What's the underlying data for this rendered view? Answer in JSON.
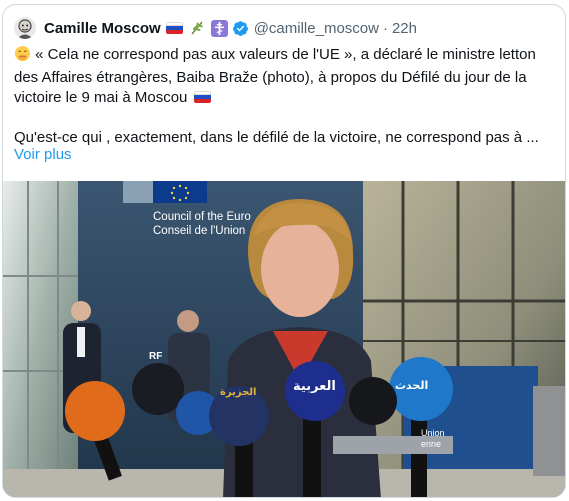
{
  "tweet": {
    "author": {
      "display_name": "Camille Moscow",
      "handle": "@camille_moscow",
      "separator": "·",
      "time": "22h",
      "avatar_icon": "avatar-illustration-icon",
      "badges": [
        "russia-flag-icon",
        "olive-sprig-icon",
        "orthodox-cross-icon",
        "verified-badge-icon"
      ]
    },
    "text": {
      "line1_pre": "« Cela ne correspond pas aux valeurs de l'UE », a déclaré le ministre letton des Affaires étrangères, Baiba Braže (photo), à propos du Défilé du jour de la victoire le 9 mai à Moscou",
      "line2": "Qu'est-ce qui , exactement, dans le défilé de la victoire, ne correspond pas à ..."
    },
    "show_more": "Voir plus",
    "colors": {
      "link": "#1d9bf0",
      "secondary_text": "#536471",
      "verified": "#1d9bf0",
      "eu_blue": "#0d3b8c"
    }
  },
  "photo": {
    "sign": {
      "line1": "Council of the Euro",
      "line2": "Conseil de l'Union"
    },
    "background_sign_bottom": {
      "line1": "Union",
      "line2": "enne"
    },
    "mic_logos": {
      "al_arabiya": "العربية",
      "al_hadath": "الحدث",
      "al_jazeera": "الجزيرة",
      "rf": "RF"
    }
  }
}
